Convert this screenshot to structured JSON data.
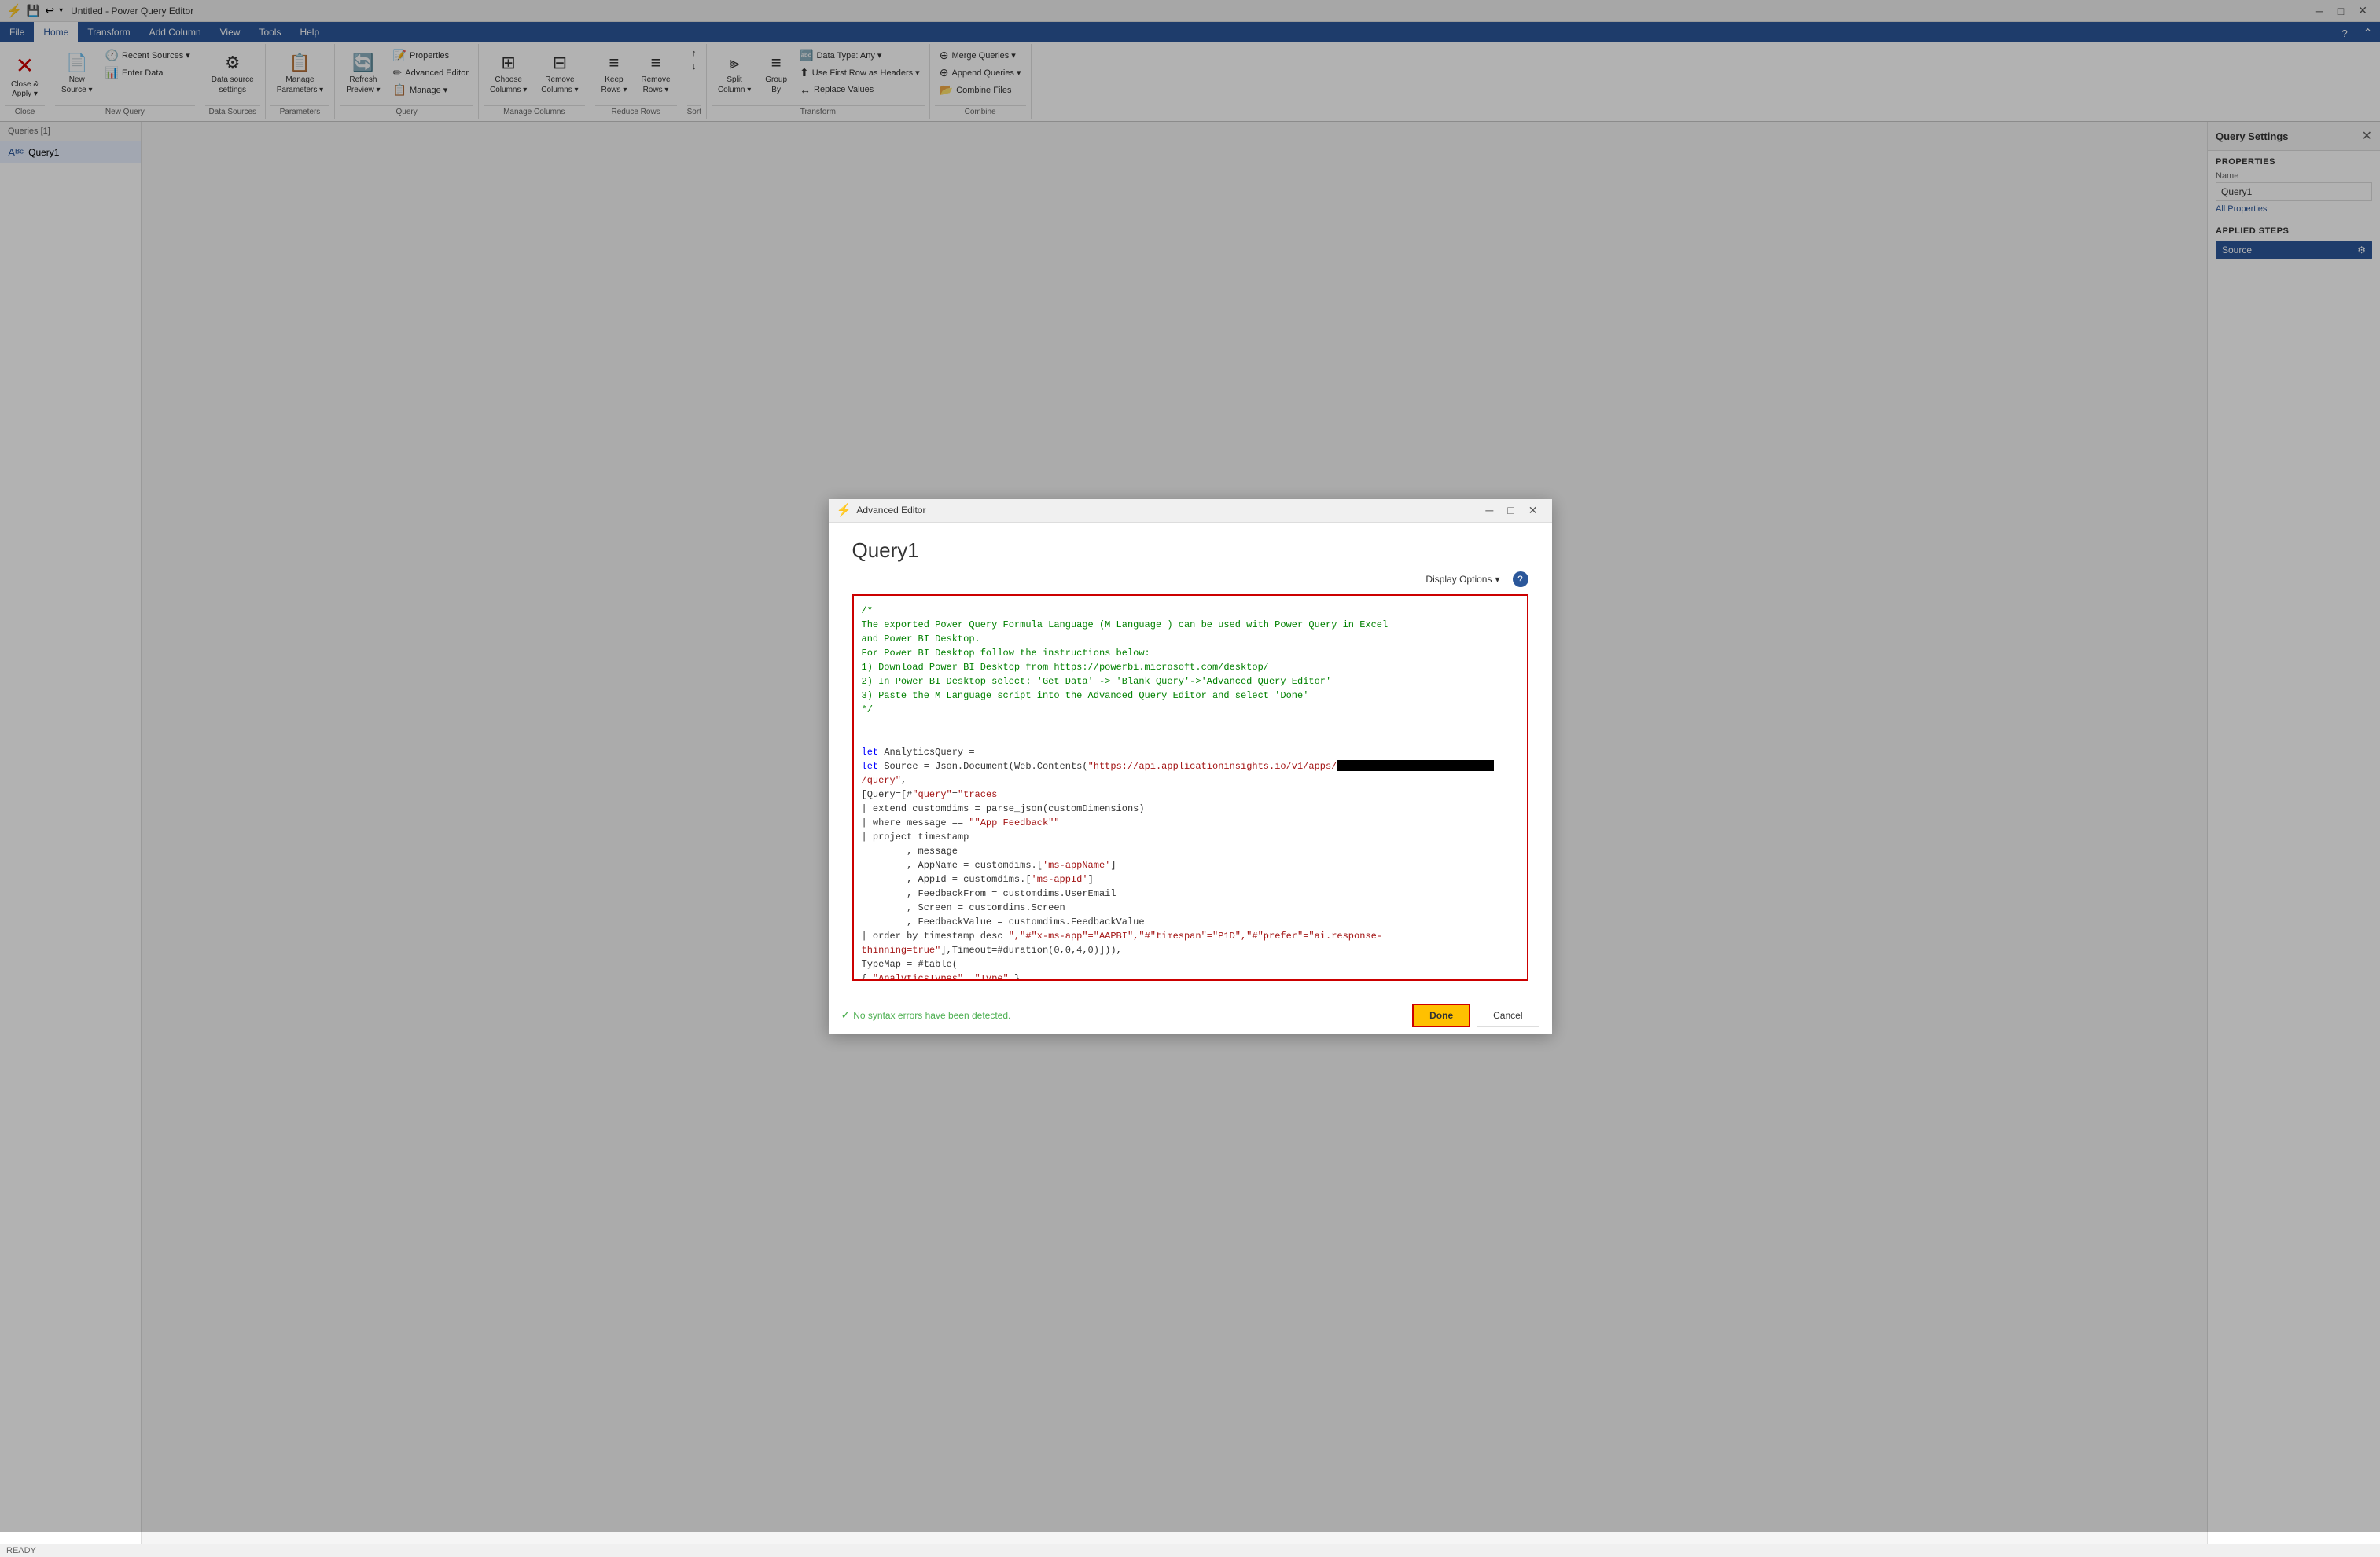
{
  "titlebar": {
    "title": "Untitled - Power Query Editor",
    "controls": [
      "minimize",
      "restore",
      "close"
    ]
  },
  "ribbon": {
    "active_tab": "Home",
    "tabs": [
      "File",
      "Home",
      "Transform",
      "Add Column",
      "View",
      "Tools",
      "Help"
    ],
    "file_tab": "File",
    "groups": [
      {
        "name": "Close",
        "label": "Close",
        "buttons": [
          {
            "id": "close-apply",
            "label": "Close &\nApply",
            "icon": "✕",
            "has_dropdown": true
          }
        ]
      },
      {
        "name": "New Query",
        "label": "New Query",
        "buttons": [
          {
            "id": "new-source",
            "label": "New\nSource",
            "icon": "📄",
            "has_dropdown": true
          },
          {
            "id": "recent-sources",
            "label": "Recent\nSources",
            "icon": "🕐",
            "has_dropdown": true
          },
          {
            "id": "enter-data",
            "label": "Enter\nData",
            "icon": "📊"
          }
        ]
      },
      {
        "name": "Data Sources",
        "label": "Data Sources",
        "buttons": [
          {
            "id": "data-source-settings",
            "label": "Data source\nsettings",
            "icon": "⚙"
          }
        ]
      },
      {
        "name": "Parameters",
        "label": "Parameters",
        "buttons": [
          {
            "id": "manage-parameters",
            "label": "Manage\nParameters",
            "icon": "📋",
            "has_dropdown": true
          }
        ]
      },
      {
        "name": "Query",
        "label": "Query",
        "buttons": [
          {
            "id": "refresh-preview",
            "label": "Refresh\nPreview",
            "icon": "🔄",
            "has_dropdown": true
          },
          {
            "id": "properties",
            "label": "Properties",
            "icon": "📝"
          },
          {
            "id": "advanced-editor",
            "label": "Advanced Editor",
            "icon": "📝"
          },
          {
            "id": "manage",
            "label": "Manage",
            "icon": "📋",
            "has_dropdown": true
          }
        ]
      },
      {
        "name": "Manage Columns",
        "label": "Manage Columns",
        "buttons": [
          {
            "id": "choose-columns",
            "label": "Choose\nColumns",
            "icon": "⊞",
            "has_dropdown": true
          },
          {
            "id": "remove-columns",
            "label": "Remove\nColumns",
            "icon": "⊟",
            "has_dropdown": true
          }
        ]
      },
      {
        "name": "Reduce Rows",
        "label": "Reduce Rows",
        "buttons": [
          {
            "id": "keep-rows",
            "label": "Keep\nRows",
            "icon": "≡",
            "has_dropdown": true
          },
          {
            "id": "remove-rows",
            "label": "Remove\nRows",
            "icon": "≡",
            "has_dropdown": true
          }
        ]
      },
      {
        "name": "Sort",
        "label": "Sort",
        "buttons": [
          {
            "id": "sort-asc",
            "label": "",
            "icon": "↑"
          },
          {
            "id": "sort-desc",
            "label": "",
            "icon": "↓"
          }
        ]
      },
      {
        "name": "Transform",
        "label": "Transform",
        "buttons": [
          {
            "id": "split-column",
            "label": "Split\nColumn",
            "icon": "⫸",
            "has_dropdown": true
          },
          {
            "id": "group-by",
            "label": "Group\nBy",
            "icon": "≡"
          },
          {
            "id": "data-type",
            "label": "Data Type: Any",
            "icon": "🔤",
            "has_dropdown": true
          },
          {
            "id": "use-first-row",
            "label": "Use First Row as Headers",
            "icon": "⬆",
            "has_dropdown": true
          },
          {
            "id": "replace-values",
            "label": "Replace Values",
            "icon": "↔"
          }
        ]
      },
      {
        "name": "Combine",
        "label": "Combine",
        "buttons": [
          {
            "id": "merge-queries",
            "label": "Merge Queries",
            "icon": "⊕",
            "has_dropdown": true
          },
          {
            "id": "append-queries",
            "label": "Append Queries",
            "icon": "⊕",
            "has_dropdown": true
          },
          {
            "id": "combine-files",
            "label": "Combine Files",
            "icon": "📂"
          }
        ]
      }
    ]
  },
  "queries_panel": {
    "header": "Queries [1]",
    "items": [
      {
        "id": "query1",
        "name": "Query1",
        "icon": "Aᴮᶜ"
      }
    ]
  },
  "query_settings": {
    "title": "Query Settings",
    "properties_section": "PROPERTIES",
    "name_label": "Name",
    "name_value": "Query1",
    "all_properties_link": "All Properties",
    "applied_steps_section": "APPLIED STEPS",
    "steps": [
      {
        "id": "source",
        "name": "Source"
      }
    ]
  },
  "status_bar": {
    "text": "READY"
  },
  "modal": {
    "title": "Advanced Editor",
    "title_icon": "⚡",
    "query_name": "Query1",
    "display_options_label": "Display Options",
    "help_label": "?",
    "no_errors_text": "No syntax errors have been detected.",
    "done_label": "Done",
    "cancel_label": "Cancel",
    "code": {
      "comment_block": "/*\nThe exported Power Query Formula Language (M Language ) can be used with Power Query in Excel\nand Power BI Desktop.\nFor Power BI Desktop follow the instructions below:\n1) Download Power BI Desktop from https://powerbi.microsoft.com/desktop/\n2) In Power BI Desktop select: 'Get Data' -> 'Blank Query'->'Advanced Query Editor'\n3) Paste the M Language script into the Advanced Query Editor and select 'Done'\n*/",
      "code_block": "let AnalyticsQuery =\nlet Source = Json.Document(Web.Contents(\"https://api.applicationinsights.io/v1/apps/[REDACTED]/query\",\n[Query=[#\"query\"=\"traces\n| extend customdims = parse_json(customDimensions)\n| where message == \"\"App Feedback\"\"\n| project timestamp\n        , message\n        , AppName = customdims.['ms-appName']\n        , AppId = customdims.['ms-appId']\n        , FeedbackFrom = customdims.UserEmail\n        , Screen = customdims.Screen\n        , FeedbackValue = customdims.FeedbackValue\n| order by timestamp desc \",#\"x-ms-app\"=\"AAPBI\",#\"timespan\"=\"P1D\",#\"prefer\"=\"ai.response-thinning=true\"],Timeout=#duration(0,0,4,0)])),\nTypeMap = #table(\n{ \"AnalyticsTypes\", \"Type\" },\n{\n{ \"string\",    Text.Type },\n{ \"int\",       Int32.Type },\n{ \"long\",      Int64.Type },\n{ \"real\",      Double.Type },\n{ \"timespan\",  Duration.Type },\n{ \"datetime\",  DateTimeZone.Type },\n{ \"bool\",      Logical.Type },\n{ \"guid\",      Text.Type },\n{ \"dynamic\",   Text.Type }"
    }
  }
}
